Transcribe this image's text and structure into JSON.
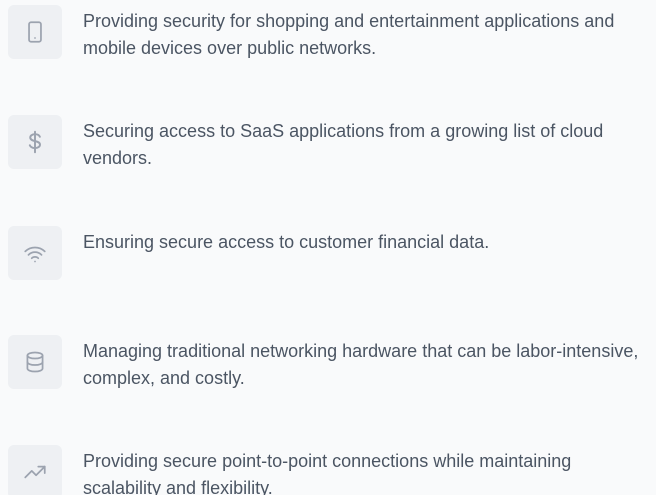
{
  "features": [
    {
      "icon": "device-mobile-icon",
      "text": "Providing security for shopping and entertainment applications and mobile devices over public networks."
    },
    {
      "icon": "dollar-icon",
      "text": "Securing access to SaaS applications from a growing list of cloud vendors."
    },
    {
      "icon": "wifi-icon",
      "text": "Ensuring secure access to customer financial data."
    },
    {
      "icon": "database-icon",
      "text": "Managing traditional networking hardware that can be labor-intensive, complex, and costly."
    },
    {
      "icon": "trending-up-icon",
      "text": "Providing secure point-to-point connections while maintaining scalability and flexibility."
    }
  ],
  "colors": {
    "background": "#f9fafb",
    "icon_box": "#eef0f3",
    "icon_stroke": "#9ca3af",
    "text": "#4b5563"
  }
}
